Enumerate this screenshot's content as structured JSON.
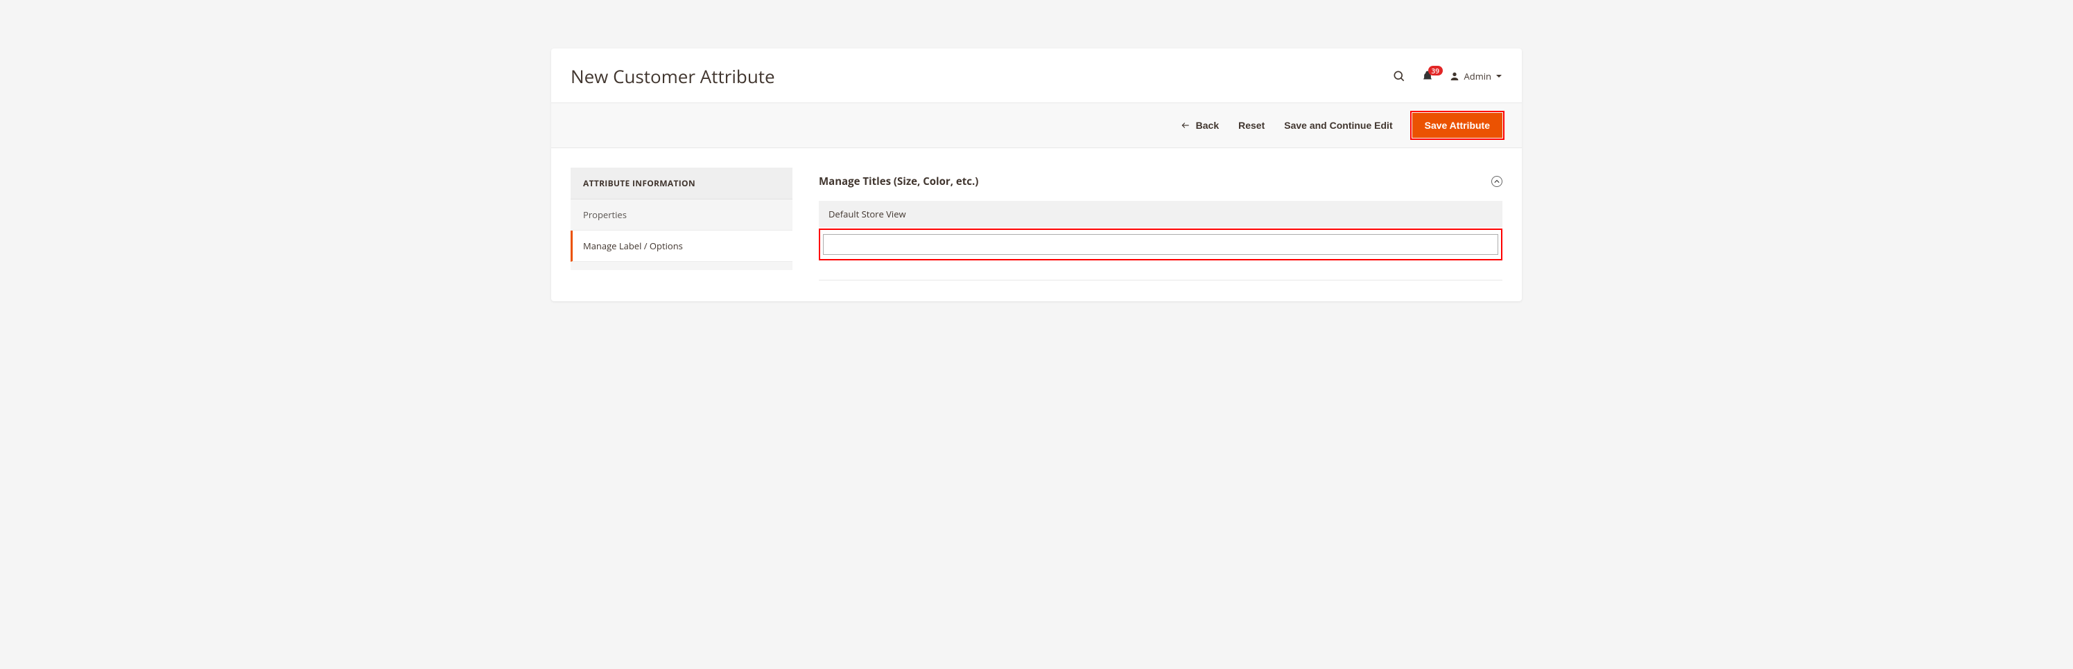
{
  "header": {
    "title": "New Customer Attribute",
    "notification_count": "39",
    "admin_label": "Admin"
  },
  "actions": {
    "back": "Back",
    "reset": "Reset",
    "save_continue": "Save and Continue Edit",
    "save": "Save Attribute"
  },
  "sidebar": {
    "heading": "ATTRIBUTE INFORMATION",
    "items": [
      {
        "label": "Properties",
        "active": false
      },
      {
        "label": "Manage Label / Options",
        "active": true
      }
    ]
  },
  "section": {
    "title": "Manage Titles (Size, Color, etc.)",
    "column_header": "Default Store View",
    "input_value": ""
  }
}
